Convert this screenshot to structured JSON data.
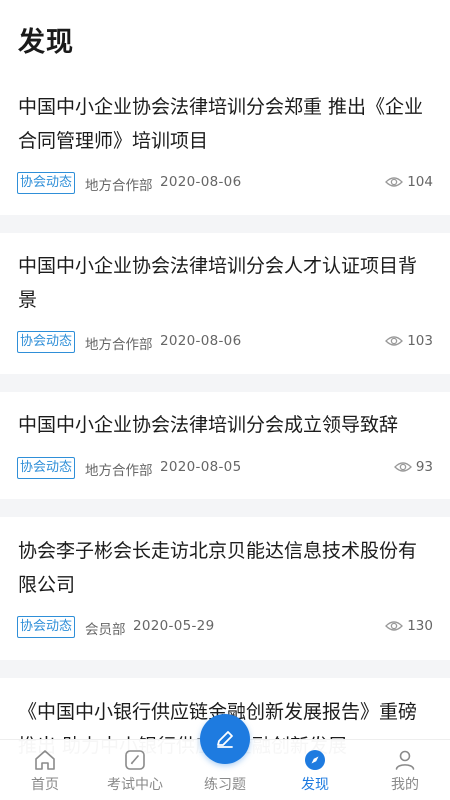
{
  "header": {
    "title": "发现"
  },
  "articles": [
    {
      "title": "中国中小企业协会法律培训分会郑重 推出《企业合同管理师》培训项目",
      "tag": "协会动态",
      "department": "地方合作部",
      "date": "2020-08-06",
      "views": "104"
    },
    {
      "title": "中国中小企业协会法律培训分会人才认证项目背景",
      "tag": "协会动态",
      "department": "地方合作部",
      "date": "2020-08-06",
      "views": "103"
    },
    {
      "title": "中国中小企业协会法律培训分会成立领导致辞",
      "tag": "协会动态",
      "department": "地方合作部",
      "date": "2020-08-05",
      "views": "93"
    },
    {
      "title": "协会李子彬会长走访北京贝能达信息技术股份有限公司",
      "tag": "协会动态",
      "department": "会员部",
      "date": "2020-05-29",
      "views": "130"
    },
    {
      "title": "《中国中小银行供应链金融创新发展报告》重磅推出 助力中小银行供应链金融创新发展",
      "tag": "",
      "department": "",
      "date": "",
      "views": ""
    }
  ],
  "tabbar": {
    "items": [
      {
        "label": "首页",
        "icon": "home-icon",
        "active": false
      },
      {
        "label": "考试中心",
        "icon": "exam-icon",
        "active": false
      },
      {
        "label": "练习题",
        "icon": "pen-icon",
        "active": false
      },
      {
        "label": "发现",
        "icon": "compass-icon",
        "active": true
      },
      {
        "label": "我的",
        "icon": "user-icon",
        "active": false
      }
    ]
  },
  "colors": {
    "accent": "#1e7be0",
    "tag": "#2f8fd8",
    "divider": "#f4f5f7"
  }
}
